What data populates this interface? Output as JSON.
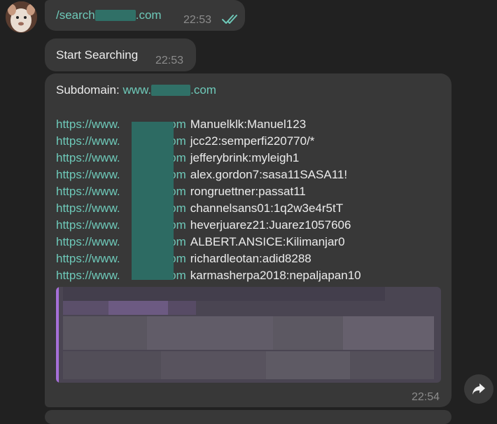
{
  "messages": {
    "command": {
      "prefix": "/search",
      "suffix": ".com",
      "time": "22:53"
    },
    "start": {
      "text": "Start Searching",
      "time": "22:53"
    },
    "results": {
      "subdomain_label": "Subdomain:",
      "subdomain_prefix": "www.",
      "subdomain_suffix": ".com",
      "rows": [
        {
          "link_prefix": "https://www.",
          "link_suffix": "com",
          "cred": "Manuelklk:Manuel123"
        },
        {
          "link_prefix": "https://www.",
          "link_suffix": "com",
          "cred": "jcc22:semperfi220770/*"
        },
        {
          "link_prefix": "https://www.",
          "link_suffix": "com",
          "cred": "jefferybrink:myleigh1"
        },
        {
          "link_prefix": "https://www.",
          "link_suffix": "com",
          "cred": "alex.gordon7:sasa11SASA11!"
        },
        {
          "link_prefix": "https://www.",
          "link_suffix": "com",
          "cred": "rongruettner:passat11"
        },
        {
          "link_prefix": "https://www.",
          "link_suffix": "com",
          "cred": "channelsans01:1q2w3e4r5tT"
        },
        {
          "link_prefix": "https://www.",
          "link_suffix": "com",
          "cred": "heverjuarez21:Juarez1057606"
        },
        {
          "link_prefix": "https://www.",
          "link_suffix": "com",
          "cred": "ALBERT.ANSICE:Kilimanjar0"
        },
        {
          "link_prefix": "https://www.",
          "link_suffix": "com",
          "cred": "richardleotan:adid8288"
        },
        {
          "link_prefix": "https://www.",
          "link_suffix": "com",
          "cred": "karmasherpa2018:nepaljapan10"
        }
      ],
      "time": "22:54"
    }
  },
  "icons": {
    "read_receipt": "double-check-icon",
    "share": "share-arrow-icon"
  },
  "colors": {
    "background": "#212121",
    "bubble": "#383838",
    "link": "#6ec9b9",
    "quote_bar": "#a66fd8"
  }
}
